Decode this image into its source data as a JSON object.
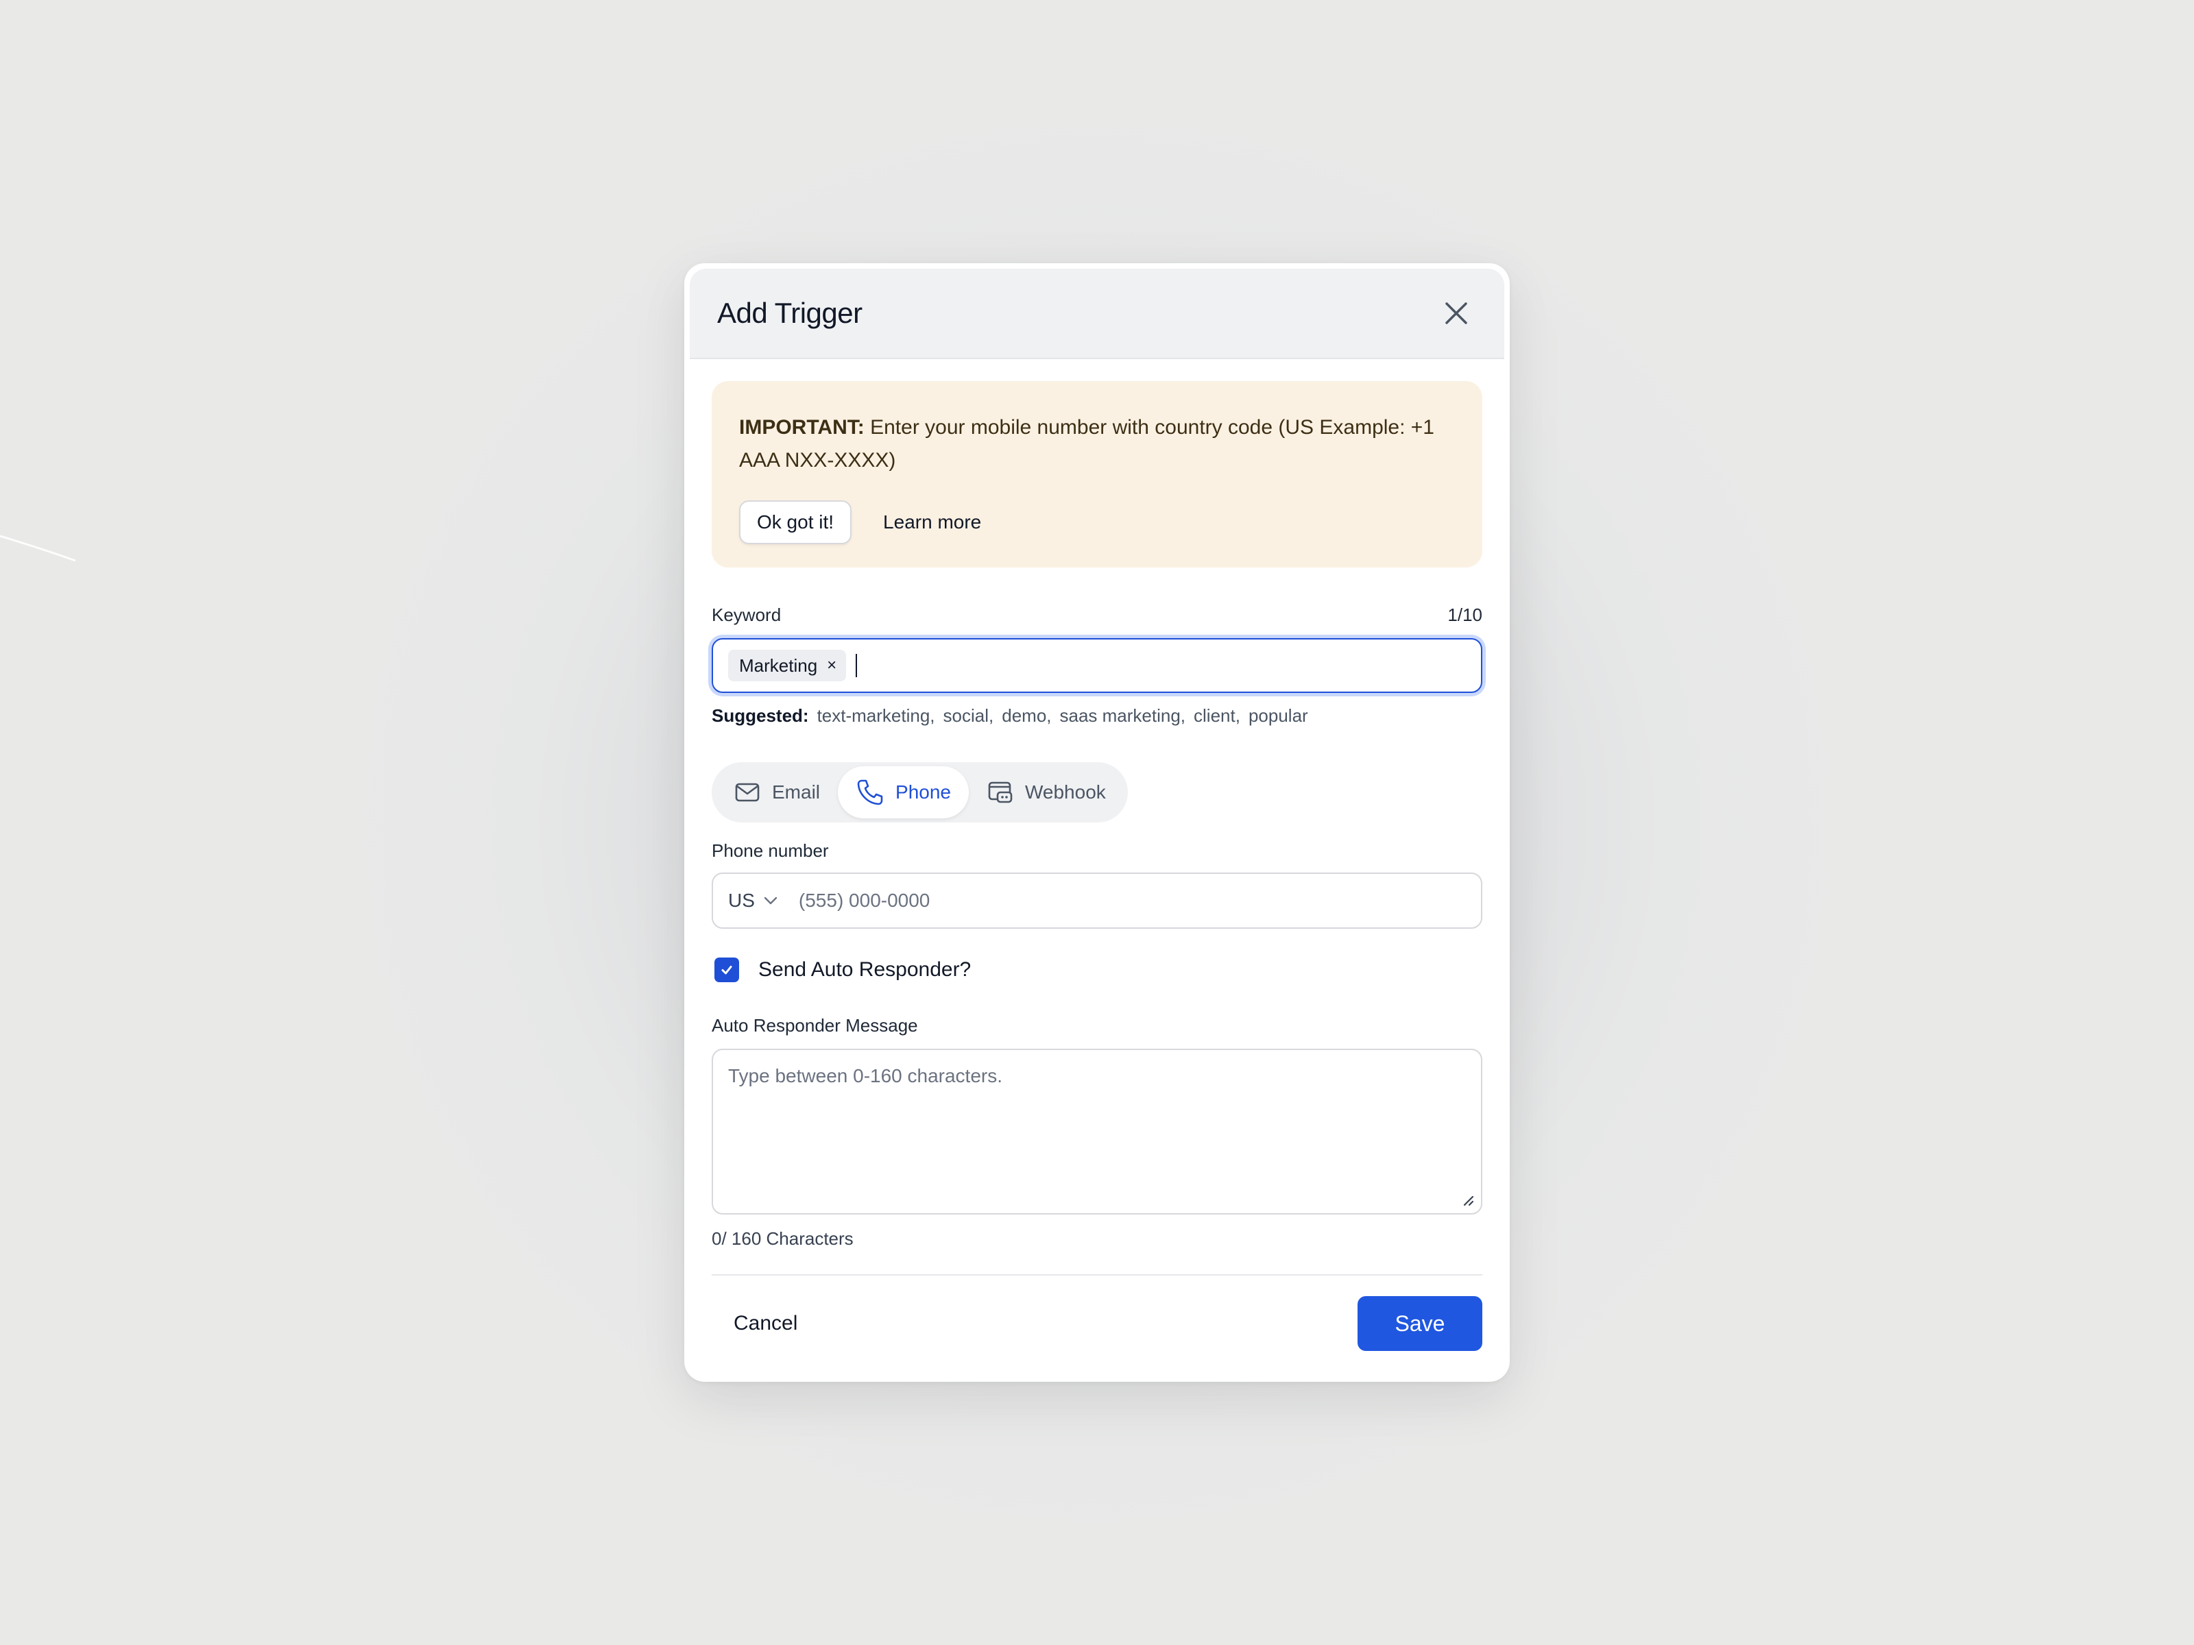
{
  "modal": {
    "title": "Add Trigger",
    "close_icon": "close-icon"
  },
  "alert": {
    "strong": "IMPORTANT:",
    "message": " Enter your mobile number with country code (US Example: +1 AAA NXX-XXXX)",
    "ok_label": "Ok got it!",
    "learn_label": "Learn more"
  },
  "keyword": {
    "label": "Keyword",
    "count": "1/10",
    "tags": [
      "Marketing"
    ],
    "remove_glyph": "×"
  },
  "suggested": {
    "label": "Suggested:",
    "items": [
      "text-marketing,",
      "social,",
      "demo,",
      "saas marketing,",
      "client,",
      "popular"
    ]
  },
  "channels": {
    "items": [
      {
        "label": "Email",
        "icon": "mail-icon"
      },
      {
        "label": "Phone",
        "icon": "phone-icon"
      },
      {
        "label": "Webhook",
        "icon": "webhook-icon"
      }
    ],
    "selected": "Phone"
  },
  "phone": {
    "label": "Phone number",
    "country": "US",
    "placeholder": "(555) 000-0000",
    "value": ""
  },
  "auto_responder": {
    "checkbox_label": "Send Auto Responder?",
    "checked": true,
    "message_label": "Auto Responder Message",
    "placeholder": "Type between 0-160 characters.",
    "char_count": "0/ 160 Characters"
  },
  "footer": {
    "cancel_label": "Cancel",
    "save_label": "Save"
  },
  "colors": {
    "primary": "#1f57e0",
    "alert_bg": "#fbf1e3",
    "header_bg": "#f0f1f3",
    "focus_ring": "#c9d8fb"
  }
}
